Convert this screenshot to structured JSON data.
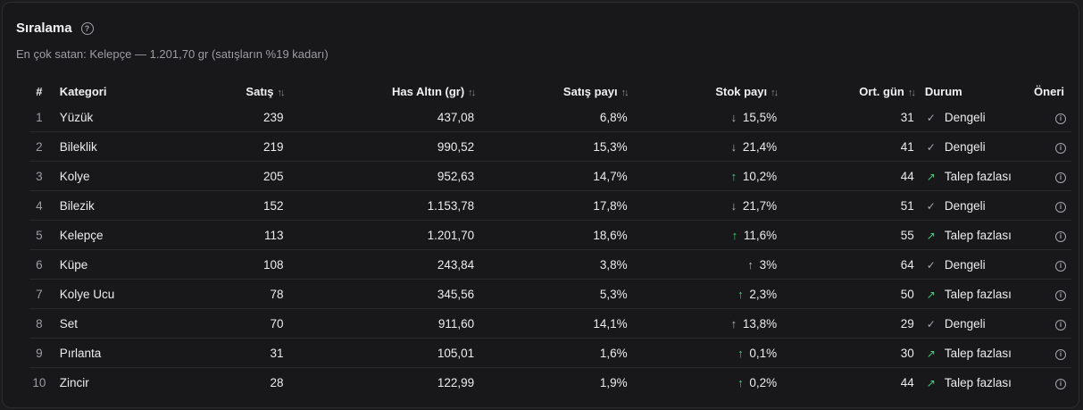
{
  "header": {
    "title": "Sıralama",
    "subtitle": "En çok satan: Kelepçe — 1.201,70 gr (satışların %19 kadarı)"
  },
  "columns": {
    "idx": "#",
    "category": "Kategori",
    "sales": "Satış",
    "gold": "Has Altın (gr)",
    "sales_share": "Satış payı",
    "stock_share": "Stok payı",
    "avg_days": "Ort. gün",
    "status": "Durum",
    "advice": "Öneri"
  },
  "icons": {
    "help": "help-circle-icon",
    "sort": "sort-arrows-icon",
    "info": "info-icon",
    "up": "arrow-up-icon",
    "down": "arrow-down-icon",
    "check": "check-icon",
    "trend": "trend-up-icon"
  },
  "colors": {
    "up": "#3dd17a",
    "trend": "#3dd17a"
  },
  "rows": [
    {
      "idx": "1",
      "category": "Yüzük",
      "sales": "239",
      "gold": "437,08",
      "sales_share": "6,8%",
      "stock_dir": "down",
      "stock_share": "15,5%",
      "avg_days": "31",
      "status_type": "check",
      "status": "Dengeli"
    },
    {
      "idx": "2",
      "category": "Bileklik",
      "sales": "219",
      "gold": "990,52",
      "sales_share": "15,3%",
      "stock_dir": "down",
      "stock_share": "21,4%",
      "avg_days": "41",
      "status_type": "check",
      "status": "Dengeli"
    },
    {
      "idx": "3",
      "category": "Kolye",
      "sales": "205",
      "gold": "952,63",
      "sales_share": "14,7%",
      "stock_dir": "up",
      "stock_share": "10,2%",
      "avg_days": "44",
      "status_type": "trend",
      "status": "Talep fazlası"
    },
    {
      "idx": "4",
      "category": "Bilezik",
      "sales": "152",
      "gold": "1.153,78",
      "sales_share": "17,8%",
      "stock_dir": "down",
      "stock_share": "21,7%",
      "avg_days": "51",
      "status_type": "check",
      "status": "Dengeli"
    },
    {
      "idx": "5",
      "category": "Kelepçe",
      "sales": "113",
      "gold": "1.201,70",
      "sales_share": "18,6%",
      "stock_dir": "up",
      "stock_share": "11,6%",
      "avg_days": "55",
      "status_type": "trend",
      "status": "Talep fazlası"
    },
    {
      "idx": "6",
      "category": "Küpe",
      "sales": "108",
      "gold": "243,84",
      "sales_share": "3,8%",
      "stock_dir": "neutral",
      "stock_share": "3%",
      "avg_days": "64",
      "status_type": "check",
      "status": "Dengeli"
    },
    {
      "idx": "7",
      "category": "Kolye Ucu",
      "sales": "78",
      "gold": "345,56",
      "sales_share": "5,3%",
      "stock_dir": "up",
      "stock_share": "2,3%",
      "avg_days": "50",
      "status_type": "trend",
      "status": "Talep fazlası"
    },
    {
      "idx": "8",
      "category": "Set",
      "sales": "70",
      "gold": "911,60",
      "sales_share": "14,1%",
      "stock_dir": "neutral",
      "stock_share": "13,8%",
      "avg_days": "29",
      "status_type": "check",
      "status": "Dengeli"
    },
    {
      "idx": "9",
      "category": "Pırlanta",
      "sales": "31",
      "gold": "105,01",
      "sales_share": "1,6%",
      "stock_dir": "up",
      "stock_share": "0,1%",
      "avg_days": "30",
      "status_type": "trend",
      "status": "Talep fazlası"
    },
    {
      "idx": "10",
      "category": "Zincir",
      "sales": "28",
      "gold": "122,99",
      "sales_share": "1,9%",
      "stock_dir": "up",
      "stock_share": "0,2%",
      "avg_days": "44",
      "status_type": "trend",
      "status": "Talep fazlası"
    }
  ]
}
